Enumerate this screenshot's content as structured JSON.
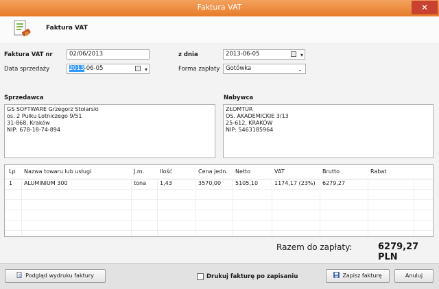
{
  "window": {
    "title": "Faktura VAT",
    "close": "✕"
  },
  "header": {
    "title": "Faktura VAT",
    "icon": "invoice-pen-icon"
  },
  "form": {
    "invoice_no_label": "Faktura VAT nr",
    "invoice_no_value": "02/06/2013",
    "issue_date_label": "z dnia",
    "issue_date_value": "2013-06-05",
    "sale_date_label": "Data sprzedaży",
    "sale_date_selected": "2013",
    "sale_date_rest": "-06-05",
    "payment_label": "Forma zapłaty",
    "payment_value": "Gotówka"
  },
  "seller": {
    "label": "Sprzedawca",
    "lines": [
      "GS SOFTWARE Grzegorz Stolarski",
      "os. 2 Pułku Lotniczego 9/51",
      "31-868, Kraków",
      "NIP: 678-18-74-894"
    ]
  },
  "buyer": {
    "label": "Nabywca",
    "lines": [
      "ZŁOMTUR",
      "OS. AKADEMICKIE 3/13",
      "25-612, KRAKÓW",
      "NIP: 5463185964"
    ]
  },
  "table": {
    "columns": [
      "Lp",
      "Nazwa towaru lub usługi",
      "J.m.",
      "Ilość",
      "Cena jedn.",
      "Netto",
      "VAT",
      "Brutto",
      "Rabat"
    ],
    "rows": [
      [
        "1",
        "ALUMINIUM 300",
        "tona",
        "1,43",
        "3570,00",
        "5105,10",
        "1174,17 (23%)",
        "6279,27",
        ""
      ]
    ]
  },
  "totals": {
    "label": "Razem do zapłaty:",
    "value": "6279,27 PLN"
  },
  "footer": {
    "preview_button": "Podgląd wydruku faktury",
    "print_checkbox": "Drukuj fakturę po zapisaniu",
    "save_button": "Zapisz fakturę",
    "cancel_button": "Anuluj"
  },
  "colors": {
    "titlebar": "#e88a3c",
    "selection": "#3399ff",
    "close": "#c9422f"
  }
}
